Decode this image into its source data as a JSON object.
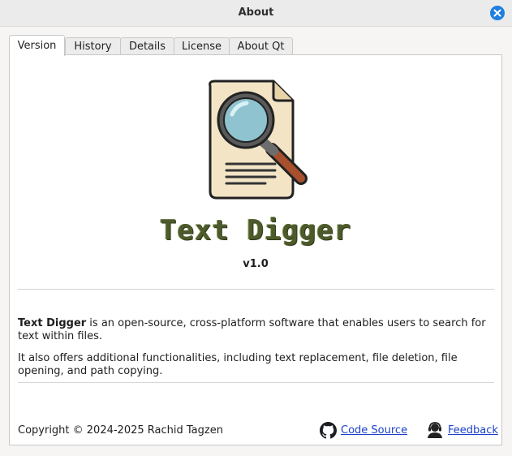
{
  "window": {
    "title": "About"
  },
  "tabs": [
    {
      "label": "Version",
      "active": true
    },
    {
      "label": "History",
      "active": false
    },
    {
      "label": "Details",
      "active": false
    },
    {
      "label": "License",
      "active": false
    },
    {
      "label": "About Qt",
      "active": false
    }
  ],
  "app": {
    "name": "Text Digger",
    "version": "v1.0",
    "logo_icon": "document-magnifier-icon"
  },
  "description": {
    "p1_name": "Text Digger",
    "p1_rest": " is an open-source, cross-platform software that enables users to search for text within files.",
    "p2": "It also offers additional functionalities, including text replacement, file deletion, file opening, and path copying."
  },
  "footer": {
    "copyright": "Copyright © 2024-2025 Rachid Tagzen",
    "code_source_label": "Code Source",
    "code_source_icon": "github-icon",
    "feedback_label": "Feedback",
    "feedback_icon": "support-agent-icon"
  },
  "colors": {
    "accent": "#1f7fe0",
    "link": "#1a3fc8",
    "app_name": "#4d5a2c"
  }
}
